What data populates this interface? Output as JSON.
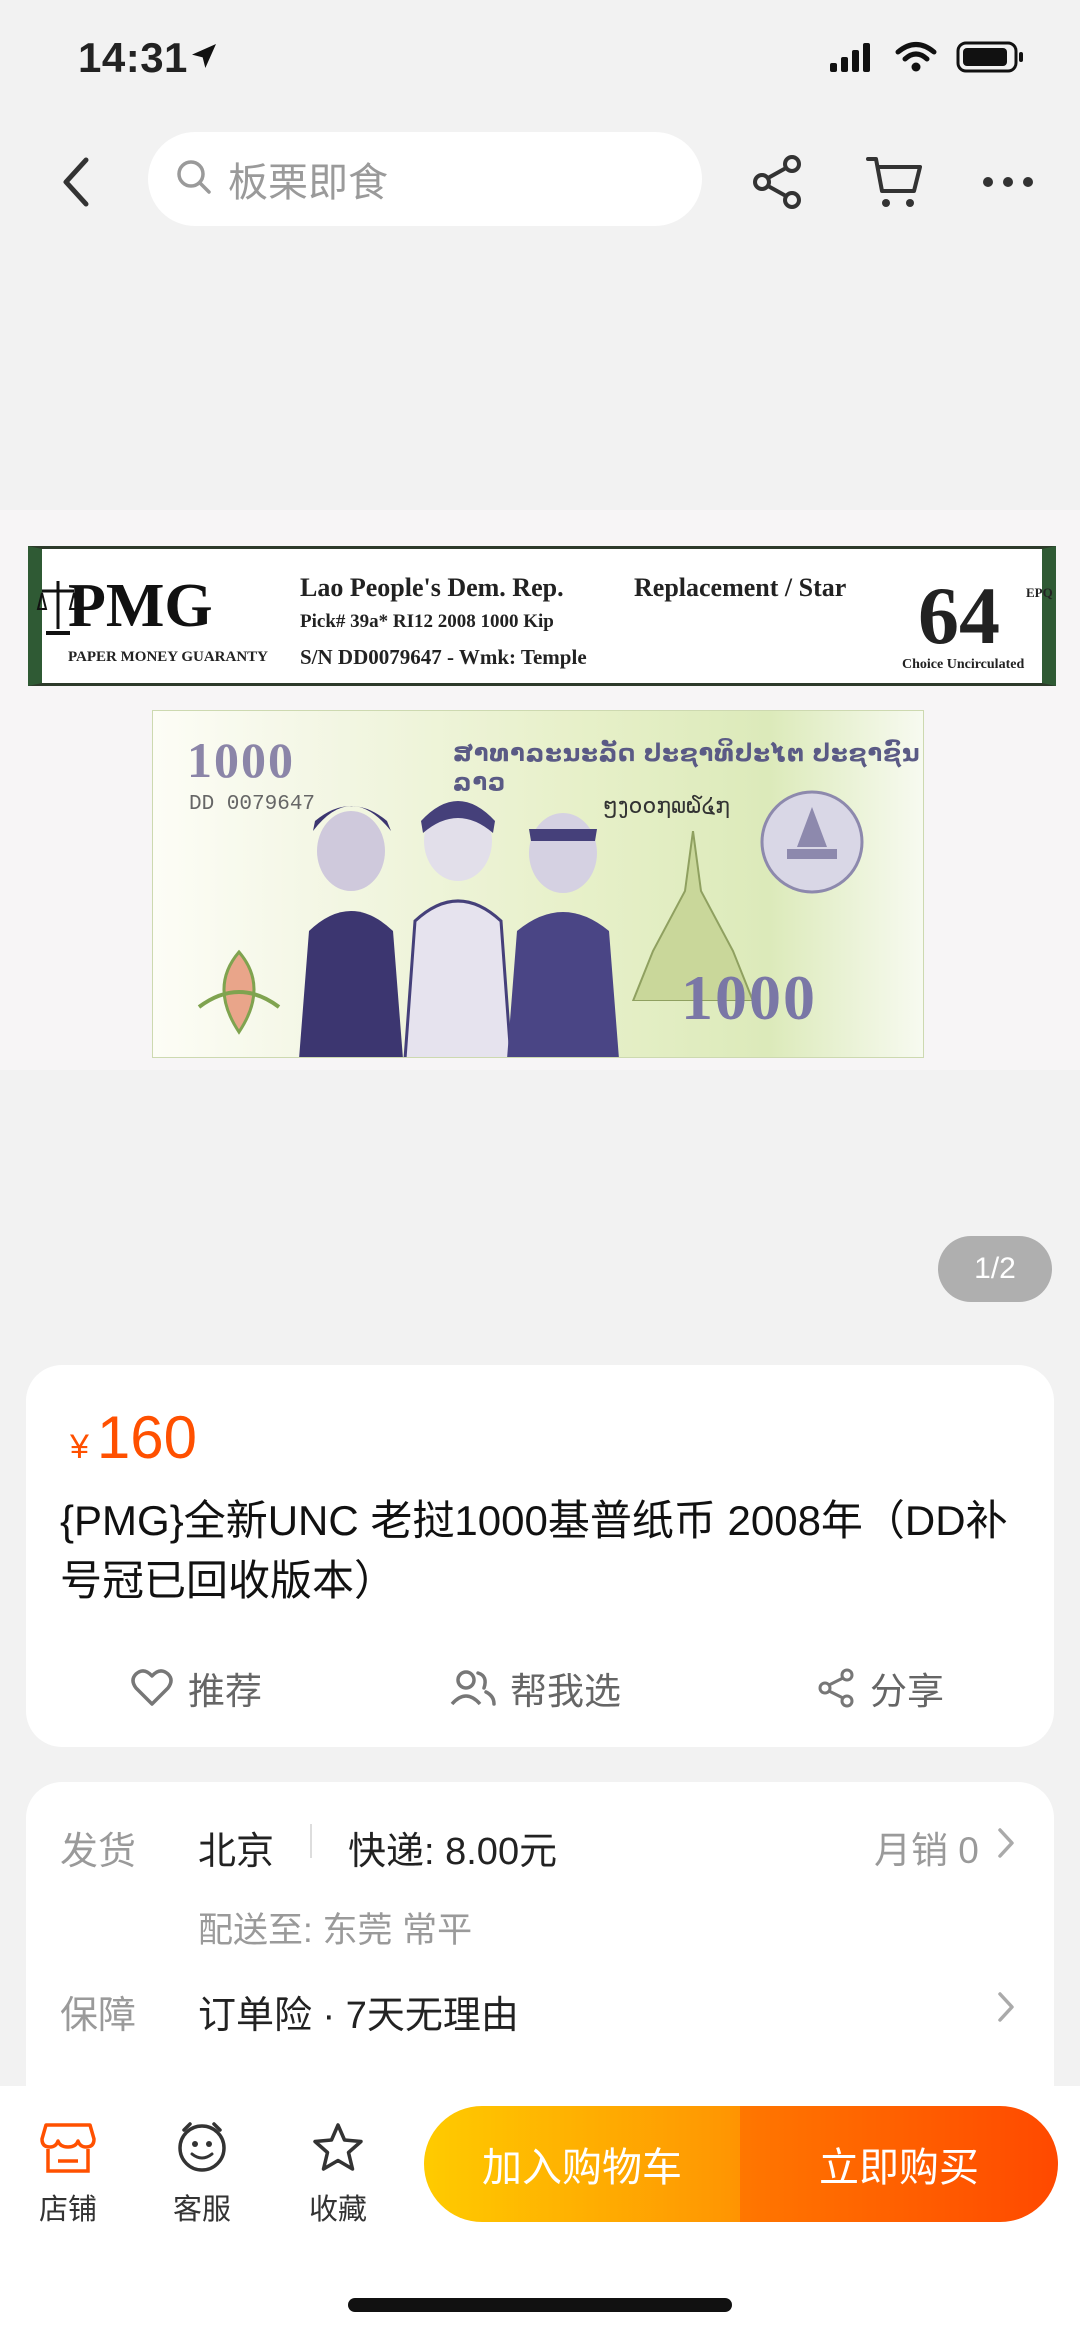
{
  "status_bar": {
    "time": "14:31"
  },
  "nav": {
    "search_placeholder": "板栗即食"
  },
  "gallery": {
    "pager": "1/2",
    "label": {
      "logo": "PMG",
      "logo_sub": "PAPER MONEY GUARANTY",
      "country": "Lao People's Dem. Rep.",
      "type": "Replacement / Star",
      "pick": "Pick# 39a*   RI12    2008   1000 Kip",
      "serial": "S/N DD0079647 - Wmk: Temple",
      "grade": "64",
      "epq": "EPQ",
      "grade_desc": "Choice Uncirculated"
    },
    "note": {
      "denom_top": "1000",
      "serial": "DD 0079647",
      "header": "ສາທາລະນະລັດ ປະຊາທິປະໄຕ ປະຊາຊົນລາວ",
      "lao_serial": "ໆງ໐໐໗໙໖໔໗",
      "denom_bottom": "1000"
    }
  },
  "product": {
    "currency": "¥",
    "price": "160",
    "title": "{PMG}全新UNC 老挝1000基普纸币 2008年（DD补号冠已回收版本）",
    "actions": {
      "recommend": "推荐",
      "help_choose": "帮我选",
      "share": "分享"
    }
  },
  "shipping": {
    "ship_label": "发货",
    "origin": "北京",
    "express": "快递: 8.00元",
    "monthly_sales": "月销 0",
    "deliver_to": "配送至: 东莞 常平",
    "guarantee_label": "保障",
    "guarantee_value": "订单险 · 7天无理由"
  },
  "bottom_bar": {
    "store": "店铺",
    "service": "客服",
    "favorite": "收藏",
    "add_to_cart": "加入购物车",
    "buy_now": "立即购买"
  },
  "colors": {
    "accent": "#ff5000",
    "cart_btn": "#ffb300",
    "buy_btn": "#ff5a00"
  }
}
